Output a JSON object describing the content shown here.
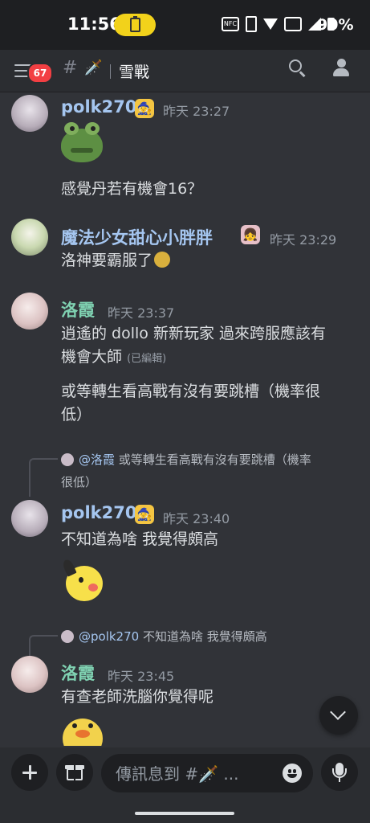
{
  "status": {
    "time": "11:56",
    "battery": "90%",
    "nfc_label": "NFC"
  },
  "header": {
    "badge_count": "67",
    "channel_emoji": "🗡️",
    "channel_name": "雪戰"
  },
  "messages": [
    {
      "author": "polk270",
      "badge_emoji": "🧙",
      "timestamp": "昨天 23:27",
      "sticker": "frog-sticker",
      "text": "感覺丹若有機會16？"
    },
    {
      "author": "魔法少女甜心小胖胖",
      "badge_emoji": "👧",
      "timestamp": "昨天 23:29",
      "text": "洛神要霸服了"
    },
    {
      "author": "洛霞",
      "timestamp": "昨天 23:37",
      "text_line1": "逍遙的 dollo 新新玩家 過來跨服應該有",
      "text_line2": "機會大師",
      "edited": "(已編輯)",
      "text2_line1": "或等轉生看高戰有沒有要跳槽（機率很",
      "text2_line2": "低）"
    },
    {
      "reply_to": "@洛霞",
      "reply_text_line1": "或等轉生看高戰有沒有要跳槽（機率",
      "reply_text_line2": "很低）",
      "author": "polk270",
      "badge_emoji": "🧙",
      "timestamp": "昨天 23:40",
      "text": "不知道為啥 我覺得頗高",
      "sticker": "pikachu-sticker"
    },
    {
      "reply_to": "@polk270",
      "reply_text": "不知道為啥 我覺得頗高",
      "author": "洛霞",
      "timestamp": "昨天 23:45",
      "text": "有查老師洗腦你覺得呢",
      "sticker": "chick-sticker"
    }
  ],
  "composer": {
    "placeholder": "傳訊息到 #🗡️ ..."
  },
  "colors": {
    "background": "#313338",
    "bar": "#2b2d31",
    "name_blue": "#a5c6f0",
    "name_green": "#7fd1b1",
    "badge_red": "#f23f43"
  }
}
